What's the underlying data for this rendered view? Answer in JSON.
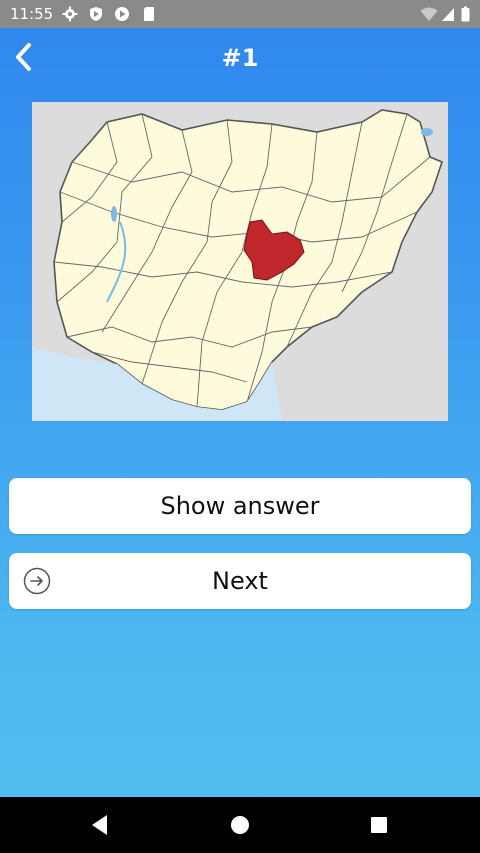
{
  "status_bar": {
    "time": "11:55",
    "icons": [
      "settings-icon",
      "shield-icon",
      "play-icon",
      "sd-card-icon",
      "wifi-icon",
      "signal-icon",
      "battery-icon"
    ]
  },
  "app_bar": {
    "title": "#1",
    "back_icon": "chevron-left-icon"
  },
  "map": {
    "subject": "Nigeria states map",
    "highlight_color": "#c0272d",
    "land_color": "#fefbdc",
    "neighbor_color": "#dcdcdc",
    "water_color": "#cfe6f6"
  },
  "buttons": {
    "show_answer": "Show answer",
    "next": "Next"
  },
  "nav_bar": {
    "icons": [
      "back-triangle-icon",
      "home-circle-icon",
      "recents-square-icon"
    ]
  }
}
